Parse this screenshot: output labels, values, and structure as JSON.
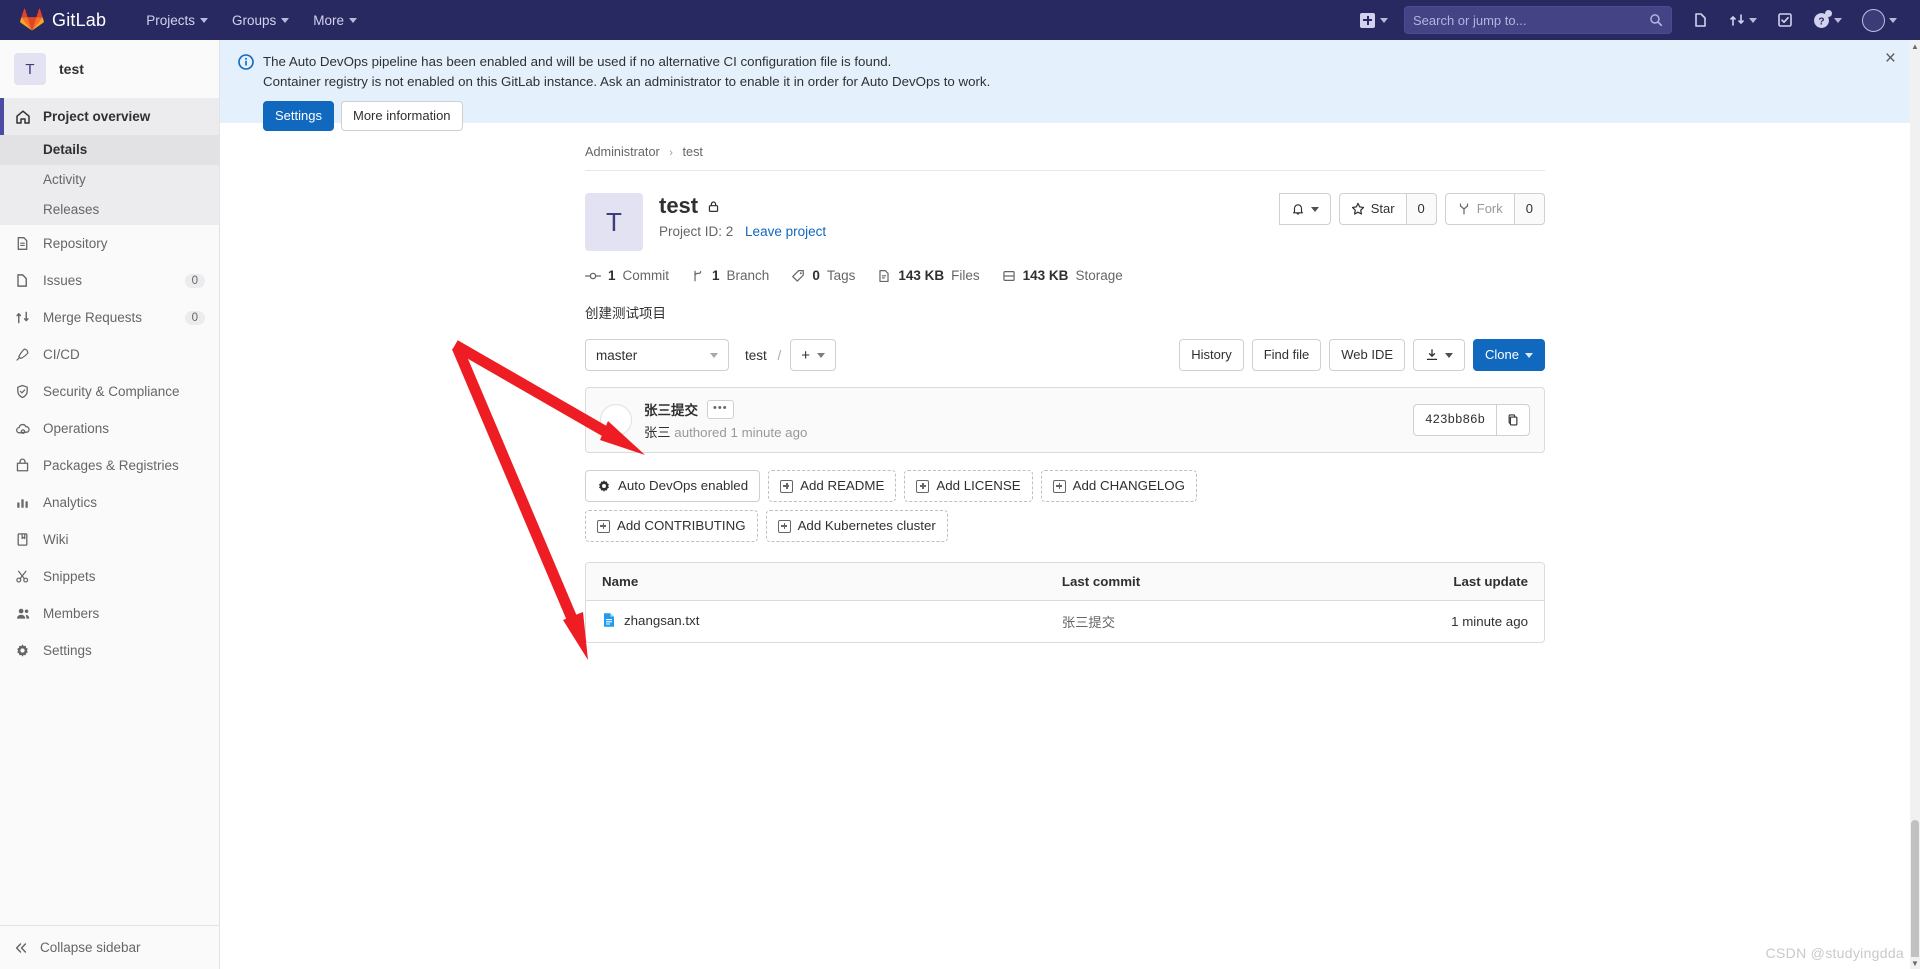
{
  "topnav": {
    "brand": "GitLab",
    "links": [
      {
        "label": "Projects",
        "icon": "chevron-down-icon"
      },
      {
        "label": "Groups",
        "icon": "chevron-down-icon"
      },
      {
        "label": "More",
        "icon": "chevron-down-icon"
      }
    ],
    "search": {
      "placeholder": "Search or jump to...",
      "value": "",
      "icon": "search-icon"
    },
    "icons": [
      {
        "name": "issues-icon"
      },
      {
        "name": "merge-requests-icon"
      },
      {
        "name": "todos-icon"
      },
      {
        "name": "help-icon"
      },
      {
        "name": "user-avatar-icon"
      }
    ],
    "create_new_label": "plus-icon"
  },
  "sidebar": {
    "project": {
      "initial": "T",
      "name": "test"
    },
    "items": [
      {
        "label": "Project overview",
        "icon": "home-icon",
        "active": true
      },
      {
        "label": "Repository",
        "icon": "document-icon"
      },
      {
        "label": "Issues",
        "icon": "issues-icon",
        "badge": "0"
      },
      {
        "label": "Merge Requests",
        "icon": "merge-requests-icon",
        "badge": "0"
      },
      {
        "label": "CI/CD",
        "icon": "rocket-icon"
      },
      {
        "label": "Security & Compliance",
        "icon": "shield-icon"
      },
      {
        "label": "Operations",
        "icon": "cloud-gear-icon"
      },
      {
        "label": "Packages & Registries",
        "icon": "package-icon"
      },
      {
        "label": "Analytics",
        "icon": "chart-icon"
      },
      {
        "label": "Wiki",
        "icon": "book-icon"
      },
      {
        "label": "Snippets",
        "icon": "scissors-icon"
      },
      {
        "label": "Members",
        "icon": "users-icon"
      },
      {
        "label": "Settings",
        "icon": "gear-icon"
      }
    ],
    "subitems": [
      {
        "label": "Details",
        "current": true
      },
      {
        "label": "Activity",
        "current": false
      },
      {
        "label": "Releases",
        "current": false
      }
    ],
    "collapse": {
      "label": "Collapse sidebar",
      "icon": "chevron-double-left-icon"
    }
  },
  "alert": {
    "icon": "info-icon",
    "line1": "The Auto DevOps pipeline has been enabled and will be used if no alternative CI configuration file is found.",
    "line2": "Container registry is not enabled on this GitLab instance. Ask an administrator to enable it in order for Auto DevOps to work.",
    "settings_label": "Settings",
    "more_info_label": "More information",
    "close_icon": "close-icon"
  },
  "breadcrumb": {
    "owner": "Administrator",
    "separator": "›",
    "project": "test"
  },
  "project": {
    "initial": "T",
    "title": "test",
    "visibility_icon": "lock-icon",
    "project_id_label": "Project ID: 2",
    "leave_label": "Leave project",
    "description": "创建测试项目",
    "notifications_icon": "bell-icon",
    "star": {
      "label": "Star",
      "count": "0",
      "icon": "star-icon"
    },
    "fork": {
      "label": "Fork",
      "count": "0",
      "icon": "fork-icon"
    },
    "stats": [
      {
        "icon": "commit-icon",
        "value": "1",
        "label": "Commit"
      },
      {
        "icon": "branch-icon",
        "value": "1",
        "label": "Branch"
      },
      {
        "icon": "tag-icon",
        "value": "0",
        "label": "Tags"
      },
      {
        "icon": "files-icon",
        "value": "143 KB",
        "label": "Files"
      },
      {
        "icon": "storage-icon",
        "value": "143 KB",
        "label": "Storage"
      }
    ]
  },
  "repo_toolbar": {
    "branch": "master",
    "path_root": "test",
    "path_separator": "/",
    "add_label": "+",
    "history_label": "History",
    "find_file_label": "Find file",
    "web_ide_label": "Web IDE",
    "download_icon": "download-icon",
    "clone_label": "Clone"
  },
  "last_commit": {
    "message": "张三提交",
    "expand_label": "•••",
    "author": "张三",
    "authored_text": "authored 1 minute ago",
    "sha": "423bb86b",
    "copy_icon": "copy-icon"
  },
  "quick_actions": [
    {
      "label": "Auto DevOps enabled",
      "icon": "gear-icon",
      "dashed": false
    },
    {
      "label": "Add README",
      "icon": "plus-box-icon",
      "dashed": true
    },
    {
      "label": "Add LICENSE",
      "icon": "plus-box-icon",
      "dashed": true
    },
    {
      "label": "Add CHANGELOG",
      "icon": "plus-box-icon",
      "dashed": true
    },
    {
      "label": "Add CONTRIBUTING",
      "icon": "plus-box-icon",
      "dashed": true
    },
    {
      "label": "Add Kubernetes cluster",
      "icon": "plus-box-icon",
      "dashed": true
    }
  ],
  "file_table": {
    "columns": [
      "Name",
      "Last commit",
      "Last update"
    ],
    "rows": [
      {
        "name": "zhangsan.txt",
        "icon": "file-text-icon",
        "last_commit": "张三提交",
        "last_update": "1 minute ago"
      }
    ]
  },
  "annotations": {
    "arrow_color": "#ee1c23",
    "count": 2
  },
  "watermark": "CSDN @studyingdda"
}
